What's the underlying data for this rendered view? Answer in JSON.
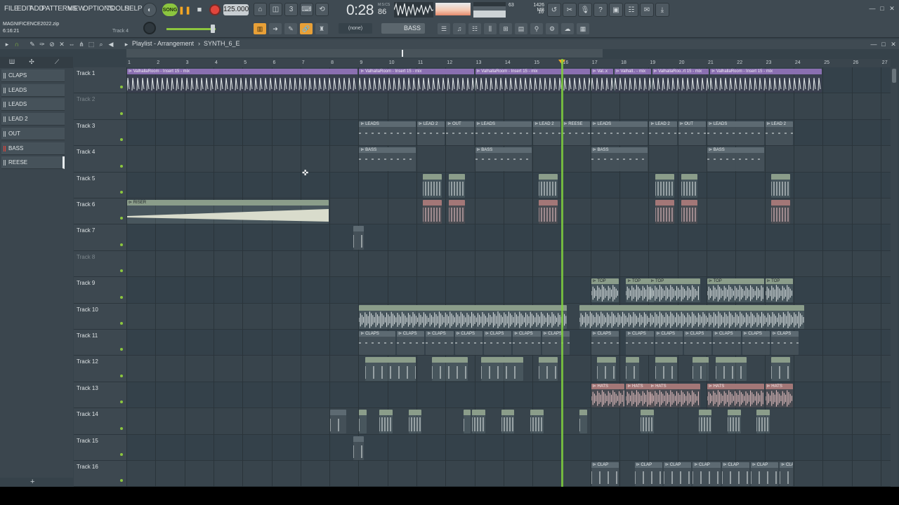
{
  "menu": [
    "FILE",
    "EDIT",
    "ADD",
    "PATTERNS",
    "VIEW",
    "OPTIONS",
    "TOOLS",
    "HELP"
  ],
  "transport": {
    "mode": "SONG",
    "tempo": "125.000",
    "time": "0:28",
    "time_ms": "86",
    "time_unit": "M:S:CS"
  },
  "monitor": {
    "cpu": "63",
    "mem": "1426 MB",
    "poly": "16"
  },
  "project": {
    "name": "MAGNIFICENCE2022.zip",
    "time": "6:16:21",
    "hint": "Track 4"
  },
  "snap": "(none)",
  "pattern_selector": "BASS",
  "playlist": {
    "title": "Playlist - Arrangement",
    "sep": "›",
    "pattern": "SYNTH_6_E"
  },
  "patterns": [
    "CLAPS",
    "LEADS",
    "LEADS",
    "LEAD 2",
    "OUT",
    "BASS",
    "REESE"
  ],
  "ruler": [
    "1",
    "2",
    "3",
    "4",
    "5",
    "6",
    "7",
    "8",
    "9",
    "10",
    "11",
    "12",
    "13",
    "14",
    "15",
    "16",
    "17",
    "18",
    "19",
    "20",
    "21",
    "22",
    "23",
    "24",
    "25",
    "26",
    "27"
  ],
  "tracks": [
    "Track 1",
    "Track 2",
    "Track 3",
    "Track 4",
    "Track 5",
    "Track 6",
    "Track 7",
    "Track 8",
    "Track 9",
    "Track 10",
    "Track 11",
    "Track 12",
    "Track 13",
    "Track 14",
    "Track 15",
    "Track 16"
  ],
  "clip_labels": {
    "t1": [
      "ValhallaRoom - Insert 15 - mix",
      "ValhallaRoom - Insert 15 - mix",
      "ValhallaRoom - Insert 15 - mix",
      "Val..x",
      "Valhall.. - mix",
      "ValhallaRoo..rt 15 - mix",
      "ValhallaRoom - Insert 15 - mix"
    ],
    "t3": [
      "LEADS",
      "LEAD 2",
      "OUT",
      "LEADS",
      "LEAD 2",
      "REESE",
      "LEADS",
      "LEAD 2",
      "OUT",
      "LEADS",
      "LEAD 2"
    ],
    "t4": [
      "BASS",
      "BASS",
      "BASS",
      "BASS"
    ],
    "t6": [
      "RISER"
    ],
    "t9": [
      "TOP",
      "TOP",
      "TOP",
      "TOP",
      "TOP"
    ],
    "t11": [
      "CLAPS",
      "CLAPS",
      "CLAPS",
      "CLAPS",
      "CLAPS",
      "CLAPS",
      "CLAPS",
      "CLAPS",
      "CLAPS",
      "CLAPS",
      "CLAPS",
      "CLAPS",
      "CLAPS",
      "CLAPS",
      "CLAPS"
    ],
    "t13": [
      "HATS",
      "HATS",
      "HATS",
      "HATS",
      "HATS"
    ],
    "t16": [
      "CLAP",
      "CLAP",
      "CLAP",
      "CLAP",
      "CLAP",
      "CLAP",
      "CLAP"
    ]
  },
  "colors": {
    "accent": "#f5a623",
    "playhead": "#7fcf3f",
    "song": "#8cc63f",
    "record": "#e2453c"
  }
}
